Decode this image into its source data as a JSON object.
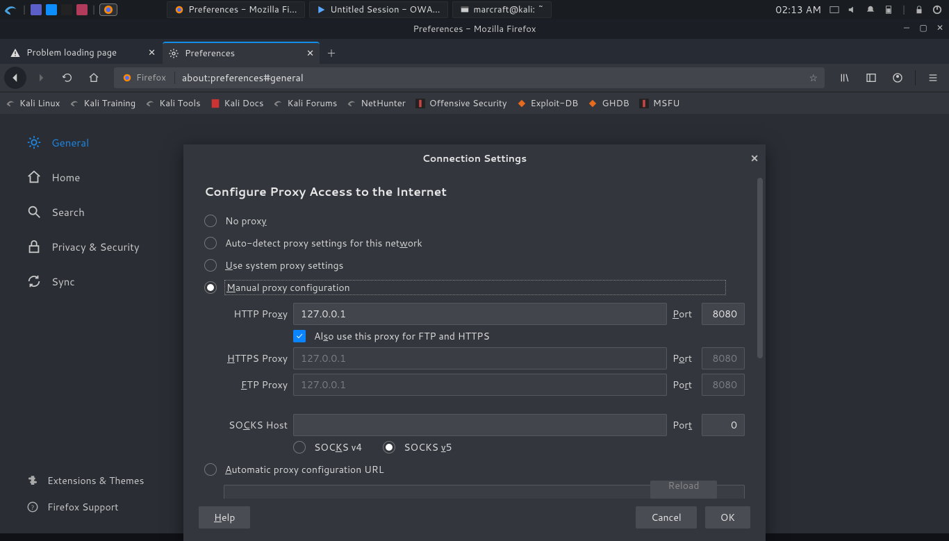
{
  "panel": {
    "tasks": [
      {
        "label": "Preferences - Mozilla Fi…",
        "active": false
      },
      {
        "label": "Untitled Session - OWA…",
        "active": false
      },
      {
        "label": "marcraft@kali: ~",
        "active": false
      }
    ],
    "clock": "02:13 AM"
  },
  "window": {
    "title": "Preferences - Mozilla Firefox"
  },
  "tabs": [
    {
      "label": "Problem loading page",
      "active": false
    },
    {
      "label": "Preferences",
      "active": true
    }
  ],
  "url": {
    "prefix": "Firefox",
    "value": "about:preferences#general"
  },
  "bookmarks": [
    "Kali Linux",
    "Kali Training",
    "Kali Tools",
    "Kali Docs",
    "Kali Forums",
    "NetHunter",
    "Offensive Security",
    "Exploit-DB",
    "GHDB",
    "MSFU"
  ],
  "sidenav": {
    "items": [
      {
        "label": "General",
        "selected": true
      },
      {
        "label": "Home",
        "selected": false
      },
      {
        "label": "Search",
        "selected": false
      },
      {
        "label": "Privacy & Security",
        "selected": false
      },
      {
        "label": "Sync",
        "selected": false
      }
    ],
    "bottom": [
      "Extensions & Themes",
      "Firefox Support"
    ]
  },
  "dialog": {
    "title": "Connection Settings",
    "heading": "Configure Proxy Access to the Internet",
    "radios": {
      "no_proxy": "No proxy",
      "auto_detect": "Auto-detect proxy settings for this network",
      "system": "Use system proxy settings",
      "manual": "Manual proxy configuration",
      "auto_url": "Automatic proxy configuration URL"
    },
    "labels": {
      "http": "HTTP Proxy",
      "https": "HTTPS Proxy",
      "ftp": "FTP Proxy",
      "socks": "SOCKS Host",
      "port_http": "Port",
      "port_https": "Port",
      "port_ftp": "Port",
      "port_socks": "Port",
      "also": "Also use this proxy for FTP and HTTPS",
      "s4": "SOCKS v4",
      "s5": "SOCKS v5",
      "reload": "Reload"
    },
    "values": {
      "http_host": "127.0.0.1",
      "http_port": "8080",
      "https_host": "127.0.0.1",
      "https_port": "8080",
      "ftp_host": "127.0.0.1",
      "ftp_port": "8080",
      "socks_host": "",
      "socks_port": "0"
    },
    "buttons": {
      "help": "Help",
      "cancel": "Cancel",
      "ok": "OK"
    }
  }
}
